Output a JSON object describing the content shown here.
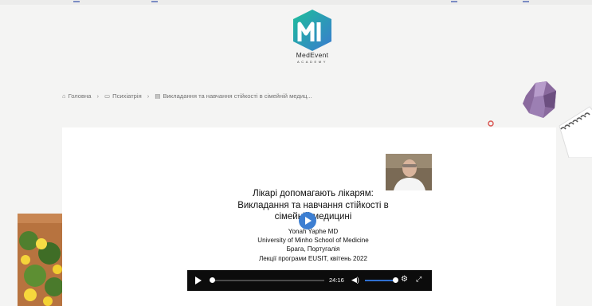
{
  "site": {
    "logo_text": "MedEvent",
    "logo_sub": "ACADEMY",
    "colors": {
      "logo_gradient_start": "#1dbf9a",
      "logo_gradient_end": "#3a7ad0"
    }
  },
  "breadcrumb": {
    "home": "Головна",
    "category": "Психіатрія",
    "current": "Викладання та навчання стійкості в сімейній медиц..."
  },
  "video": {
    "title_lines": [
      "Лікарі допомагають лікарям:",
      "Викладання та навчання стійкості в",
      "сімейній медицині"
    ],
    "author": "Yonah Yaphe MD",
    "affiliation": "University of Minho School of Medicine",
    "location": "Брага, Португалія",
    "program": "Лекції програми EUSIT, квітень 2022",
    "time": "24:16",
    "progress": 0.0,
    "volume": 0.95,
    "colors": {
      "accent": "#3d7fd2"
    }
  },
  "icons": {
    "home": "home-icon",
    "folder": "folder-icon",
    "document": "document-icon",
    "play": "play-icon",
    "volume": "volume-icon",
    "settings": "gear-icon",
    "fullscreen": "fullscreen-icon"
  }
}
